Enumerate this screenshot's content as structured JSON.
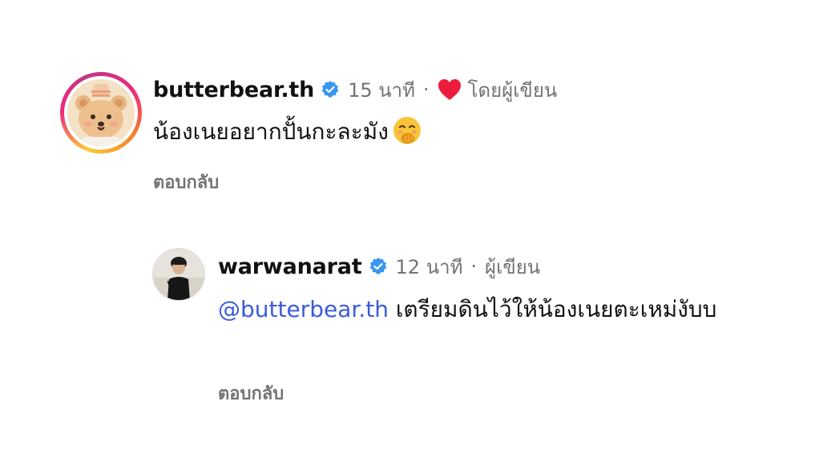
{
  "comments": [
    {
      "username": "butterbear.th",
      "time": "15 นาที",
      "separator": "·",
      "liked_by_author_label": "โดยผู้เขียน",
      "text": "น้องเนยอยากปั้นกะละมัง",
      "reply_label": "ตอบกลับ",
      "avatar_icon": "bear-avatar",
      "ring_colors": [
        "#f9ce34",
        "#ee2a7b",
        "#c13584",
        "#f58529"
      ]
    },
    {
      "username": "warwanarat",
      "time": "12 นาที",
      "separator": "·",
      "author_label": "ผู้เขียน",
      "mention": "@butterbear.th",
      "text": "เตรียมดินไว้ให้น้องเนยตะเหม่งับบ",
      "reply_label": "ตอบกลับ",
      "avatar_icon": "person-avatar"
    }
  ],
  "colors": {
    "verified": "#3897f0",
    "heart": "#ed1c3a",
    "mention": "#3b5bdb",
    "secondary_text": "#737373"
  }
}
